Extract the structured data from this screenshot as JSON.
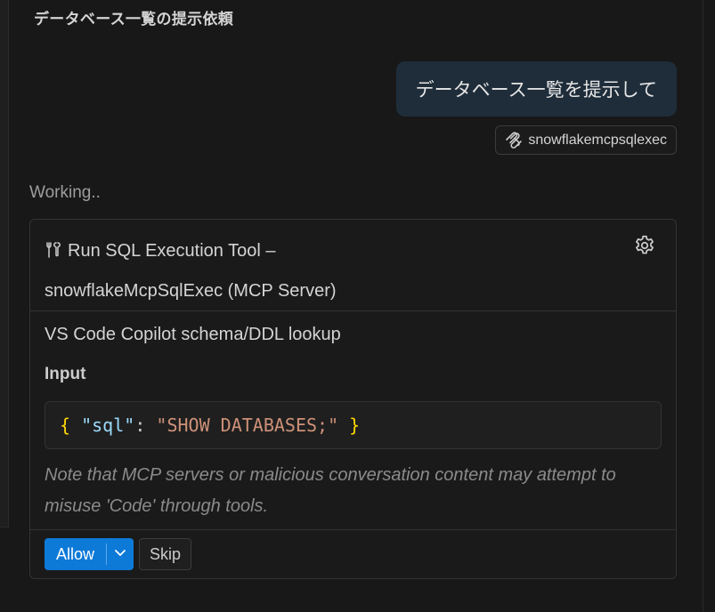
{
  "chat": {
    "title": "データベース一覧の提示依頼"
  },
  "user_message": {
    "text": "データベース一覧を提示して",
    "reference": {
      "label": "snowflakemcpsqlexec",
      "icon": "mcp-server-icon"
    }
  },
  "status": {
    "text": "Working.."
  },
  "tool_call": {
    "title_line1": "Run SQL Execution Tool –",
    "title_line2": "snowflakeMcpSqlExec (MCP Server)",
    "title_icon": "tools-icon",
    "settings_icon": "gear-icon",
    "description": "VS Code Copilot schema/DDL lookup",
    "input_label": "Input",
    "input_code": {
      "open_brace": "{",
      "key": "\"sql\"",
      "colon": ":",
      "value": "\"SHOW DATABASES;\"",
      "close_brace": "}"
    },
    "note": "Note that MCP servers or malicious conversation content may attempt to misuse 'Code' through tools.",
    "actions": {
      "allow_label": "Allow",
      "allow_dropdown_icon": "chevron-down-icon",
      "skip_label": "Skip"
    }
  },
  "colors": {
    "background": "#181818",
    "user_bubble": "#1f2d3a",
    "primary_button": "#0e7ad8",
    "json_brace": "#ffd700",
    "json_key": "#9cdcfe",
    "json_string": "#ce9178"
  }
}
